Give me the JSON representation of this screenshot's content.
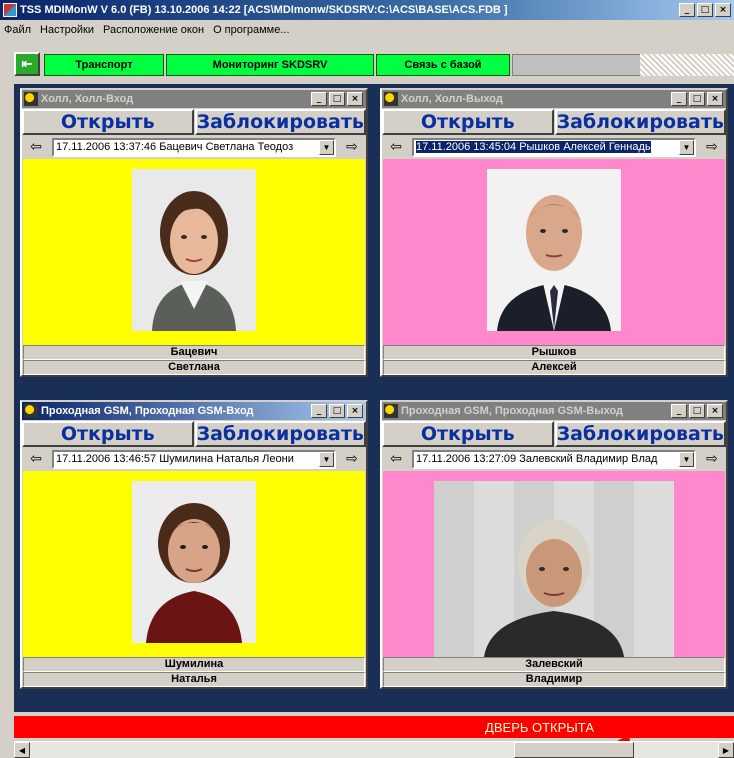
{
  "window": {
    "title": "TSS MDIMonW V 6.0 (FB) 13.10.2006 14:22 [ACS\\MDImonw/SKDSRV:C:\\ACS\\BASE\\ACS.FDB ]",
    "min": "_",
    "max": "□",
    "close": "×"
  },
  "menu": [
    "Файл",
    "Настройки",
    "Расположение окон",
    "О программе..."
  ],
  "toolbar": {
    "exit_icon": "exit-door-icon",
    "tabs": [
      "Транспорт",
      "Мониторинг SKDSRV",
      "Связь с базой"
    ]
  },
  "colors": {
    "toolbar_tab": "#00ff40",
    "pass_allowed": "#ffff00",
    "pass_exit": "#ff88cc",
    "door_alert": "#ff0000",
    "button_text": "#0a2fa0"
  },
  "cameras": [
    {
      "title": "Холл, Холл-Вход",
      "active": false,
      "open_label": "Открыть",
      "block_label": "Заблокировать",
      "event_time": "17.11.2006 13:37:46",
      "event_name": "Бацевич Светлана Теодоз",
      "selected": false,
      "bg": "#ffff00",
      "surname": "Бацевич",
      "firstname": "Светлана"
    },
    {
      "title": "Холл, Холл-Выход",
      "active": false,
      "open_label": "Открыть",
      "block_label": "Заблокировать",
      "event_time": "17.11.2006 13:45:04",
      "event_name": "Рышков Алексей Геннадь",
      "selected": true,
      "bg": "#ff88cc",
      "surname": "Рышков",
      "firstname": "Алексей"
    },
    {
      "title": "Проходная GSM, Проходная GSM-Вход",
      "active": true,
      "open_label": "Открыть",
      "block_label": "Заблокировать",
      "event_time": "17.11.2006 13:46:57",
      "event_name": "Шумилина Наталья Леони",
      "selected": false,
      "bg": "#ffff00",
      "surname": "Шумилина",
      "firstname": "Наталья"
    },
    {
      "title": "Проходная GSM, Проходная GSM-Выход",
      "active": false,
      "open_label": "Открыть",
      "block_label": "Заблокировать",
      "event_time": "17.11.2006 13:27:09",
      "event_name": "Залевский Владимир Влад",
      "selected": false,
      "bg": "#ff88cc",
      "surname": "Залевский",
      "firstname": "Владимир"
    }
  ],
  "status": {
    "door": "ДВЕРЬ ОТКРЫТА"
  }
}
